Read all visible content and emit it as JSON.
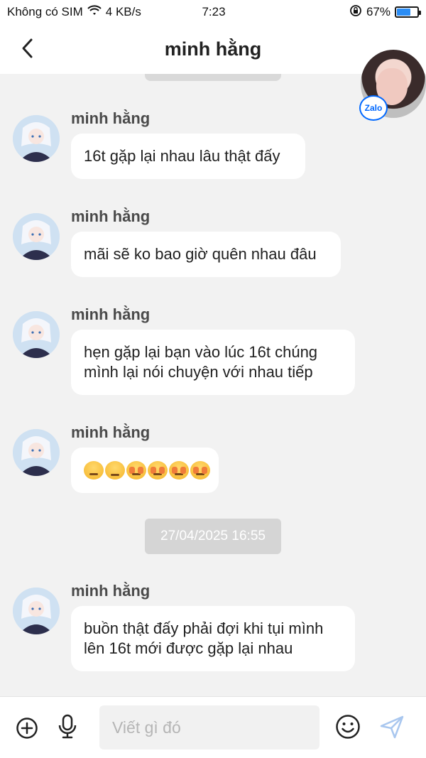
{
  "status_bar": {
    "carrier": "Không có SIM",
    "speed": "4 KB/s",
    "time": "7:23",
    "battery_percent": "67%",
    "battery_level": 0.67
  },
  "header": {
    "title": "minh hằng",
    "badge": "Zalo"
  },
  "messages": [
    {
      "sender": "minh hằng",
      "lines": [
        "16t gặp lại nhau lâu thật đấy"
      ]
    },
    {
      "sender": "minh hằng",
      "lines": [
        "mãi sẽ ko bao giờ quên nhau đâu"
      ]
    },
    {
      "sender": "minh hằng",
      "lines": [
        "hẹn gặp lại bạn vào lúc 16t chúng",
        "mình lại nói chuyện với nhau tiếp"
      ]
    },
    {
      "sender": "minh hằng",
      "emojis": [
        "expressionless-emoji",
        "sad-emoji",
        "crying-emoji",
        "crying-emoji",
        "crying-emoji",
        "crying-emoji"
      ]
    },
    {
      "sender": "minh hằng",
      "lines": [
        "buồn thật đấy phải đợi khi tụi mình",
        "lên 16t mới được gặp lại nhau"
      ]
    }
  ],
  "date_separator": "27/04/2025 16:55",
  "input": {
    "placeholder": "Viết gì đó"
  },
  "colors": {
    "accent": "#0068ff",
    "battery": "#2b8df5",
    "chat_bg": "#f2f2f2"
  }
}
